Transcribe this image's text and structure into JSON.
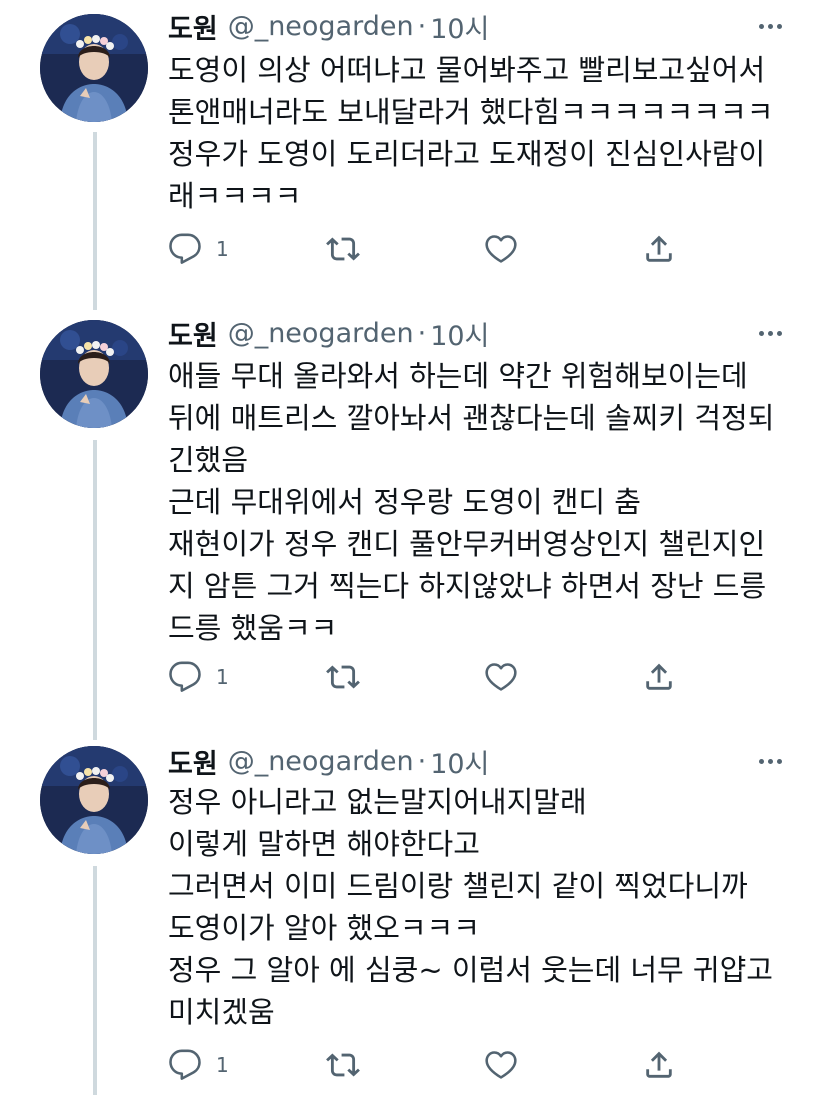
{
  "colors": {
    "thread_line": "#cfd9de",
    "muted": "#536471",
    "text": "#0f1419"
  },
  "tweets": [
    {
      "name": "도원",
      "handle": "@_neogarden",
      "separator": "·",
      "time": "10시",
      "lines": [
        "도영이 의상 어떠냐고 물어봐주고 빨리보고싶어서",
        "톤앤매너라도 보내달라거 했다힘ㅋㅋㅋㅋㅋㅋㅋㅋ",
        "정우가 도영이 도리더라고 도재정이 진심인사람이",
        "래ㅋㅋㅋㅋ"
      ],
      "reply_count": "1"
    },
    {
      "name": "도원",
      "handle": "@_neogarden",
      "separator": "·",
      "time": "10시",
      "lines": [
        "애들 무대 올라와서 하는데 약간 위험해보이는데",
        "뒤에 매트리스 깔아놔서 괜찮다는데 솔찌키 걱정되",
        "긴했음",
        "근데 무대위에서 정우랑 도영이 캔디 춤",
        "재현이가 정우 캔디 풀안무커버영상인지 챌린지인",
        "지 암튼 그거 찍는다 하지않았냐 하면서 장난 드릉",
        "드릉 했움ㅋㅋ"
      ],
      "reply_count": "1"
    },
    {
      "name": "도원",
      "handle": "@_neogarden",
      "separator": "·",
      "time": "10시",
      "lines": [
        "정우 아니라고 없는말지어내지말래",
        "이렇게 말하면 해야한다고",
        "그러면서 이미 드림이랑 챌린지 같이 찍었다니까",
        "도영이가 알아 했오ㅋㅋㅋ",
        "정우 그 알아 에 심쿵~ 이럼서 웃는데 너무 귀얍고",
        "미치겠움"
      ],
      "reply_count": "1"
    }
  ]
}
